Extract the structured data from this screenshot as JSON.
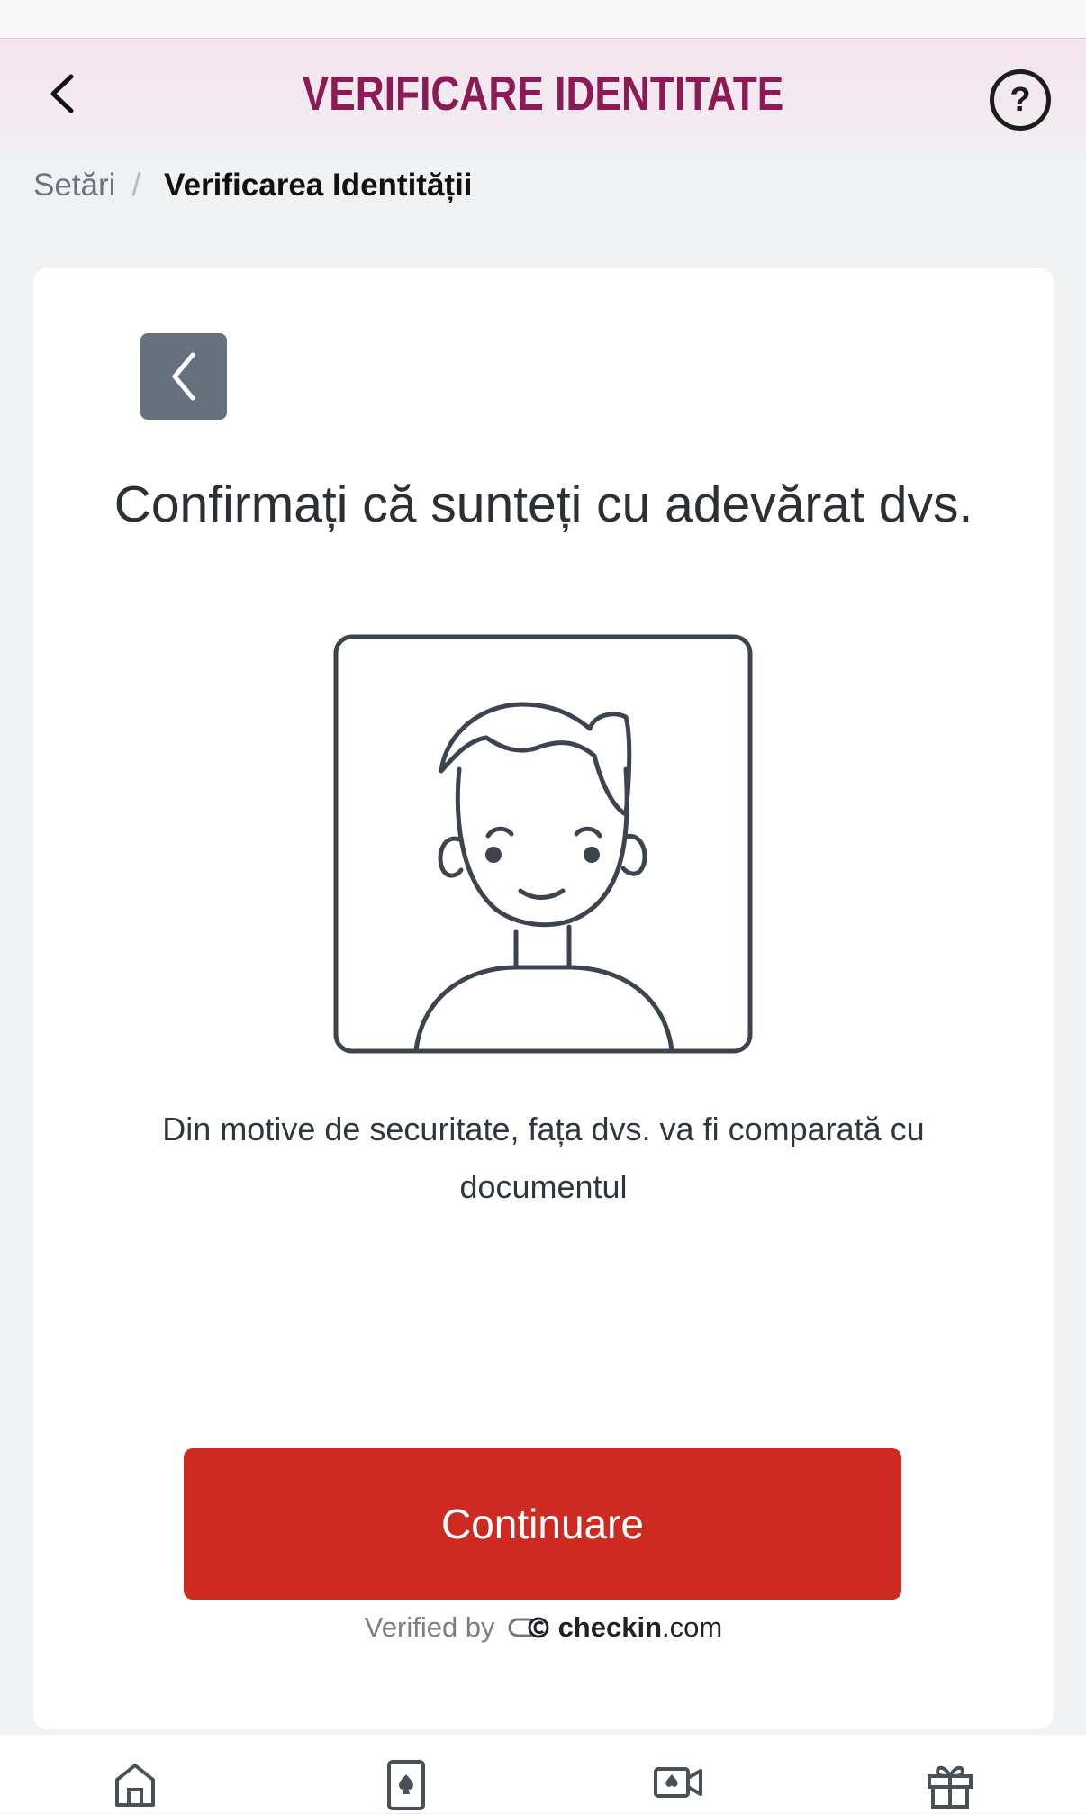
{
  "header": {
    "title": "VERIFICARE IDENTITATE",
    "help_symbol": "?",
    "back_icon": "chevron-left-icon"
  },
  "breadcrumb": {
    "parent": "Setări",
    "separator": "/",
    "current": "Verificarea Identității"
  },
  "card": {
    "heading": "Confirmați că sunteți cu adevărat dvs.",
    "illustration": "face-portrait-icon",
    "description": "Din motive de securitate, fața dvs. va fi comparată cu documentul",
    "continue_label": "Continuare",
    "verified_label": "Verified by",
    "brand_name": "checkin",
    "brand_domain": ".com"
  },
  "nav": {
    "items": [
      {
        "icon": "home-icon"
      },
      {
        "icon": "playing-card-icon"
      },
      {
        "icon": "video-camera-icon"
      },
      {
        "icon": "gift-icon"
      }
    ]
  },
  "colors": {
    "title": "#8c1a55",
    "button": "#cd2b22",
    "back_square": "#65717d"
  }
}
